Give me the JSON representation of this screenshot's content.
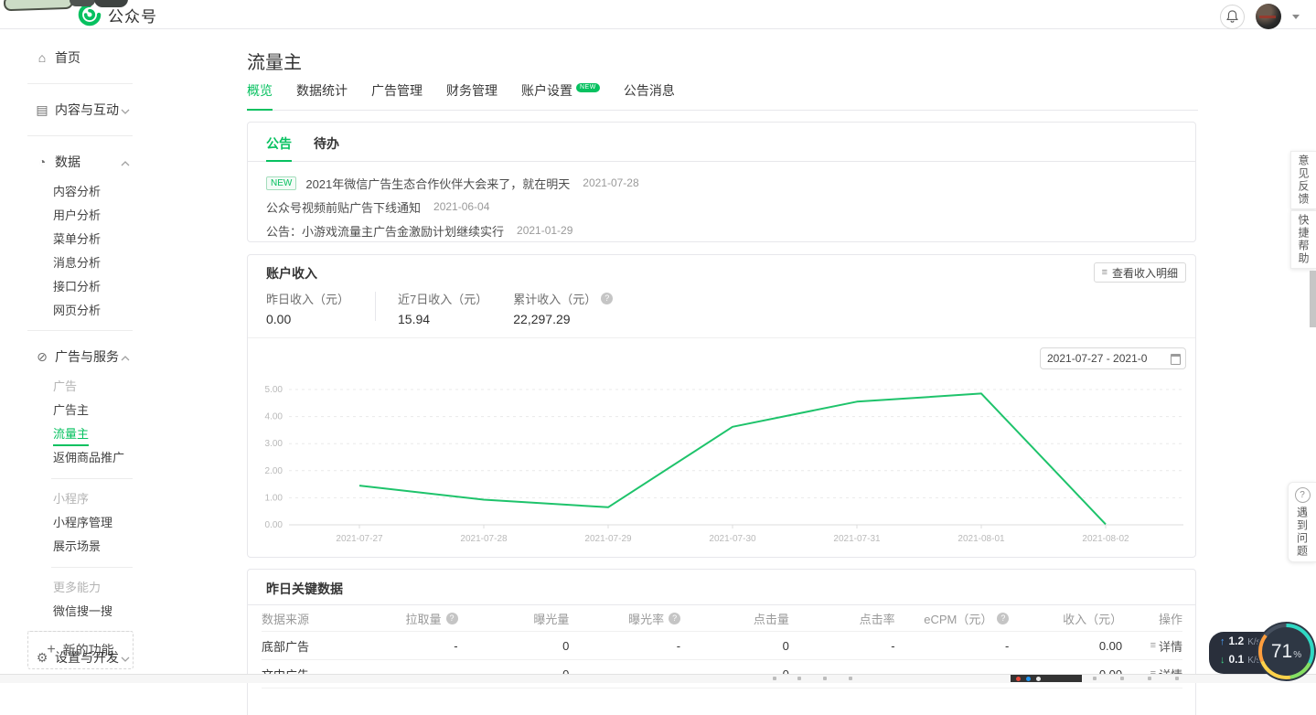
{
  "colors": {
    "accent": "#07c160",
    "chart_line": "#1ec36b"
  },
  "topbar": {
    "logo_text": "公众号"
  },
  "sidebar": {
    "items": [
      {
        "type": "item",
        "icon": "home-icon",
        "label": "首页"
      },
      {
        "type": "divider"
      },
      {
        "type": "item",
        "icon": "content-icon",
        "label": "内容与互动",
        "chevron": "down"
      },
      {
        "type": "divider"
      },
      {
        "type": "item",
        "icon": "data-icon",
        "label": "数据",
        "chevron": "up"
      },
      {
        "type": "sub",
        "label": "内容分析"
      },
      {
        "type": "sub",
        "label": "用户分析"
      },
      {
        "type": "sub",
        "label": "菜单分析"
      },
      {
        "type": "sub",
        "label": "消息分析"
      },
      {
        "type": "sub",
        "label": "接口分析"
      },
      {
        "type": "sub",
        "label": "网页分析"
      },
      {
        "type": "divider"
      },
      {
        "type": "item",
        "icon": "ad-services-icon",
        "label": "广告与服务",
        "chevron": "up"
      },
      {
        "type": "grouplabel",
        "label": "广告"
      },
      {
        "type": "sub",
        "label": "广告主"
      },
      {
        "type": "sub",
        "label": "流量主",
        "active": true
      },
      {
        "type": "sub",
        "label": "返佣商品推广"
      },
      {
        "type": "shortdivider"
      },
      {
        "type": "grouplabel",
        "label": "小程序"
      },
      {
        "type": "sub",
        "label": "小程序管理"
      },
      {
        "type": "sub",
        "label": "展示场景"
      },
      {
        "type": "shortdivider"
      },
      {
        "type": "grouplabel",
        "label": "更多能力"
      },
      {
        "type": "sub",
        "label": "微信搜一搜"
      },
      {
        "type": "divider"
      },
      {
        "type": "item",
        "icon": "gear-icon",
        "label": "设置与开发",
        "chevron": "down"
      }
    ],
    "new_feature_label": "新的功能"
  },
  "page": {
    "title": "流量主",
    "tabs": [
      {
        "label": "概览",
        "active": true
      },
      {
        "label": "数据统计"
      },
      {
        "label": "广告管理"
      },
      {
        "label": "财务管理"
      },
      {
        "label": "账户设置",
        "badge": "NEW"
      },
      {
        "label": "公告消息"
      }
    ]
  },
  "announce": {
    "tabs": [
      {
        "label": "公告",
        "active": true
      },
      {
        "label": "待办"
      }
    ],
    "items": [
      {
        "badge": "NEW",
        "text": "2021年微信广告生态合作伙伴大会来了，就在明天",
        "date": "2021-07-28"
      },
      {
        "text": "公众号视频前贴广告下线通知",
        "date": "2021-06-04"
      },
      {
        "text": "公告：小游戏流量主广告金激励计划继续实行",
        "date": "2021-01-29"
      }
    ]
  },
  "income": {
    "title": "账户收入",
    "detail_button": "查看收入明细",
    "stats": [
      {
        "label": "昨日收入（元）",
        "value": "0.00",
        "divider_after": true
      },
      {
        "label": "近7日收入（元）",
        "value": "15.94"
      },
      {
        "label": "累计收入（元）",
        "value": "22,297.29",
        "help": true
      }
    ],
    "date_range": "2021-07-27 - 2021-0"
  },
  "chart_data": {
    "type": "line",
    "x": [
      "2021-07-27",
      "2021-07-28",
      "2021-07-29",
      "2021-07-30",
      "2021-07-31",
      "2021-08-01",
      "2021-08-02"
    ],
    "values": [
      1.45,
      0.93,
      0.65,
      3.62,
      4.55,
      4.85,
      0.02
    ],
    "ylim": [
      0,
      5
    ],
    "yticks": [
      0,
      1,
      2,
      3,
      4,
      5
    ],
    "title": "",
    "xlabel": "",
    "ylabel": "",
    "grid": "dashed-horizontal",
    "legend": "none"
  },
  "table": {
    "title": "昨日关键数据",
    "columns": [
      {
        "label": "数据来源"
      },
      {
        "label": "拉取量",
        "help": true
      },
      {
        "label": "曝光量"
      },
      {
        "label": "曝光率",
        "help": true
      },
      {
        "label": "点击量"
      },
      {
        "label": "点击率"
      },
      {
        "label": "eCPM（元）",
        "help": true
      },
      {
        "label": "收入（元）"
      },
      {
        "label": "操作"
      }
    ],
    "rows": [
      [
        "底部广告",
        "-",
        "0",
        "-",
        "0",
        "-",
        "-",
        "0.00",
        "详情"
      ],
      [
        "文中广告",
        "-",
        "0",
        "-",
        "0",
        "-",
        "-",
        "0.00",
        "详情"
      ]
    ]
  },
  "side": {
    "feedback": "意见反馈",
    "quick_help": "快捷帮助",
    "problem": "遇到问题"
  },
  "monitor": {
    "up_value": "1.2",
    "up_unit": "K/s",
    "down_value": "0.1",
    "down_unit": "K/s",
    "percent": "71",
    "percent_sign": "%"
  }
}
